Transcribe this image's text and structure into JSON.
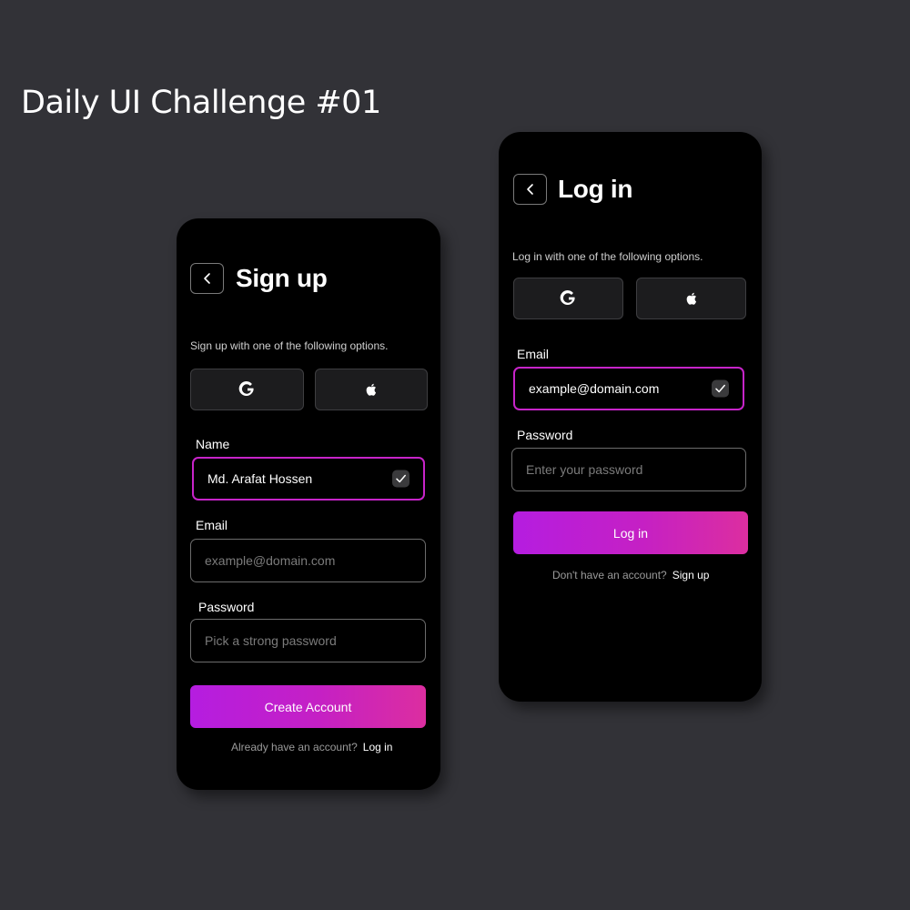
{
  "heading": "Daily UI Challenge #01",
  "signup": {
    "title": "Sign up",
    "subtitle": "Sign up with one of the following options.",
    "social": [
      "google-icon",
      "apple-icon"
    ],
    "name_label": "Name",
    "name_value": "Md. Arafat Hossen",
    "email_label": "Email",
    "email_placeholder": "example@domain.com",
    "password_label": "Password",
    "password_placeholder": "Pick a strong password",
    "submit_label": "Create Account",
    "footer_text": "Already have an account?",
    "footer_link": "Log in"
  },
  "login": {
    "title": "Log in",
    "subtitle": "Log in with one of the following options.",
    "social": [
      "google-icon",
      "apple-icon"
    ],
    "email_label": "Email",
    "email_value": "example@domain.com",
    "password_label": "Password",
    "password_placeholder": "Enter your password",
    "submit_label": "Log in",
    "footer_text": "Don't have an account?",
    "footer_link": "Sign up"
  },
  "colors": {
    "background": "#323237",
    "phone": "#000000",
    "accent": "#c724c9",
    "gradient_start": "#b51de0",
    "gradient_end": "#dc2ea0"
  }
}
